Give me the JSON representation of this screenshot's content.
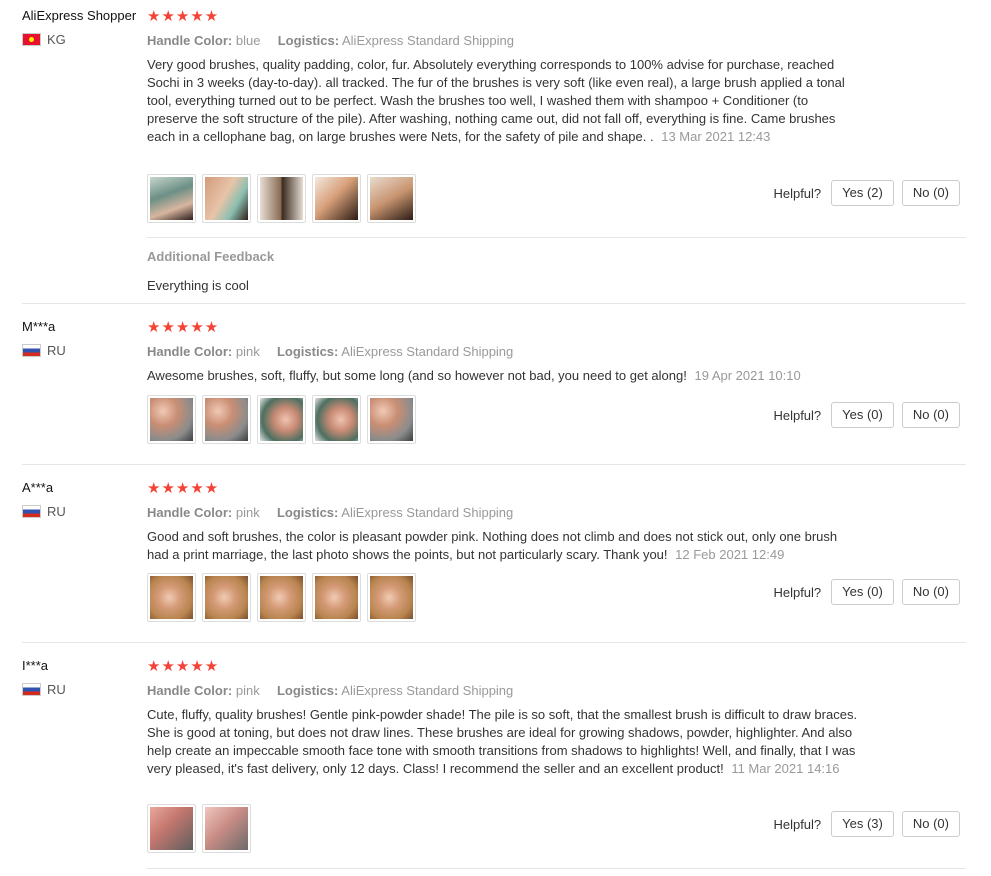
{
  "labels": {
    "handle_color": "Handle Color:",
    "logistics": "Logistics:",
    "helpful": "Helpful?",
    "additional_feedback": "Additional Feedback"
  },
  "colors": {
    "star": "#f44336",
    "divider": "#e6e6e6",
    "meta": "#999999"
  },
  "reviews": [
    {
      "user": "AliExpress Shopper",
      "country": "KG",
      "flag": "kg-flag-icon",
      "stars": "★★★★★",
      "rating": 5,
      "handle_color": "blue",
      "logistics": "AliExpress Standard Shipping",
      "text": "Very good brushes, quality padding, color, fur. Absolutely everything corresponds to 100% advise for purchase, reached Sochi in 3 weeks (day-to-day). all tracked. The fur of the brushes is very soft (like even real), a large brush applied a tonal tool, everything turned out to be perfect. Wash the brushes too well, I washed them with shampoo + Conditioner (to preserve the soft structure of the pile). After washing, nothing came out, did not fall off, everything is fine. Came brushes each in a cellophane bag, on large brushes were Nets, for the safety of pile and shape. .",
      "date": "13 Mar 2021 12:43",
      "yes": "Yes (2)",
      "no": "No (0)",
      "additional_feedback": "Everything is cool"
    },
    {
      "user": "M***a",
      "country": "RU",
      "flag": "ru-flag-icon",
      "stars": "★★★★★",
      "rating": 5,
      "handle_color": "pink",
      "logistics": "AliExpress Standard Shipping",
      "text": "Awesome brushes, soft, fluffy, but some long (and so however not bad, you need to get along!",
      "date": "19 Apr 2021 10:10",
      "yes": "Yes (0)",
      "no": "No (0)"
    },
    {
      "user": "A***a",
      "country": "RU",
      "flag": "ru-flag-icon",
      "stars": "★★★★★",
      "rating": 5,
      "handle_color": "pink",
      "logistics": "AliExpress Standard Shipping",
      "text": "Good and soft brushes, the color is pleasant powder pink. Nothing does not climb and does not stick out, only one brush had a print marriage, the last photo shows the points, but not particularly scary. Thank you!",
      "date": "12 Feb 2021 12:49",
      "yes": "Yes (0)",
      "no": "No (0)"
    },
    {
      "user": "I***a",
      "country": "RU",
      "flag": "ru-flag-icon",
      "stars": "★★★★★",
      "rating": 5,
      "handle_color": "pink",
      "logistics": "AliExpress Standard Shipping",
      "text": "Cute, fluffy, quality brushes! Gentle pink-powder shade! The pile is so soft, that the smallest brush is difficult to draw braces. She is good at toning, but does not draw lines. These brushes are ideal for growing shadows, powder, highlighter. And also help create an impeccable smooth face tone with smooth transitions from shadows to highlights! Well, and finally, that I was very pleased, it's fast delivery, only 12 days. Class! I recommend the seller and an excellent product!",
      "date": "11 Mar 2021 14:16",
      "yes": "Yes (3)",
      "no": "No (0)"
    }
  ]
}
